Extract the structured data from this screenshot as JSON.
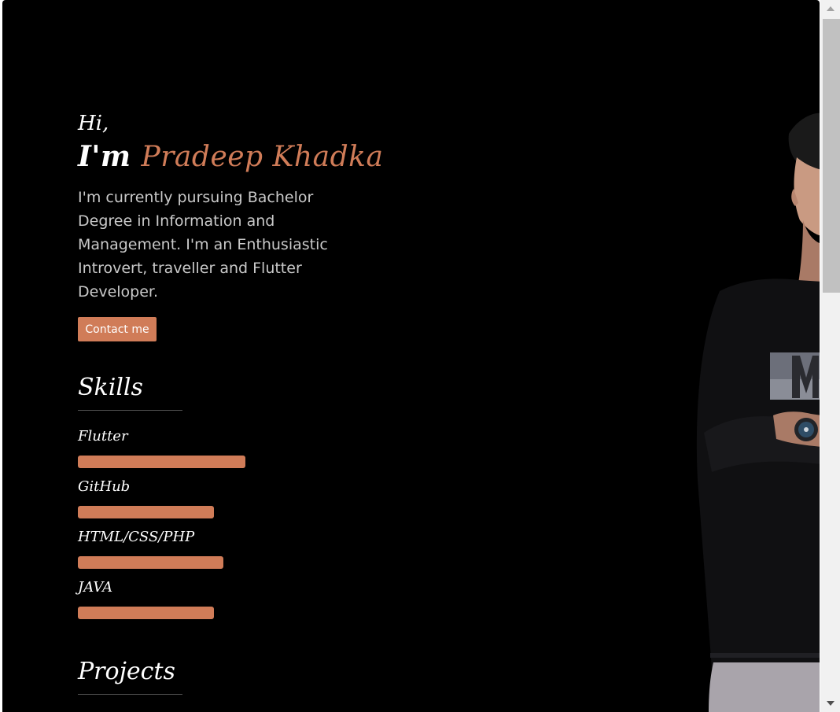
{
  "hero": {
    "greeting": "Hi,",
    "im": "I'm",
    "name": "Pradeep Khadka",
    "bio": "I'm currently pursuing Bachelor Degree in Information and Management. I'm an Enthusiastic Introvert, traveller and Flutter Developer.",
    "contact_label": "Contact me"
  },
  "skills": {
    "title": "Skills",
    "items": [
      {
        "label": "Flutter",
        "level": 0.85
      },
      {
        "label": "GitHub",
        "level": 0.69
      },
      {
        "label": "HTML/CSS/PHP",
        "level": 0.74
      },
      {
        "label": "JAVA",
        "level": 0.69
      }
    ]
  },
  "projects": {
    "title": "Projects"
  },
  "colors": {
    "background": "#000000",
    "accent": "#d07c58",
    "text": "#ffffff",
    "muted_text": "#c9c9c9"
  },
  "icons": {
    "scroll_up": "triangle-up-icon",
    "scroll_down": "triangle-down-icon"
  }
}
